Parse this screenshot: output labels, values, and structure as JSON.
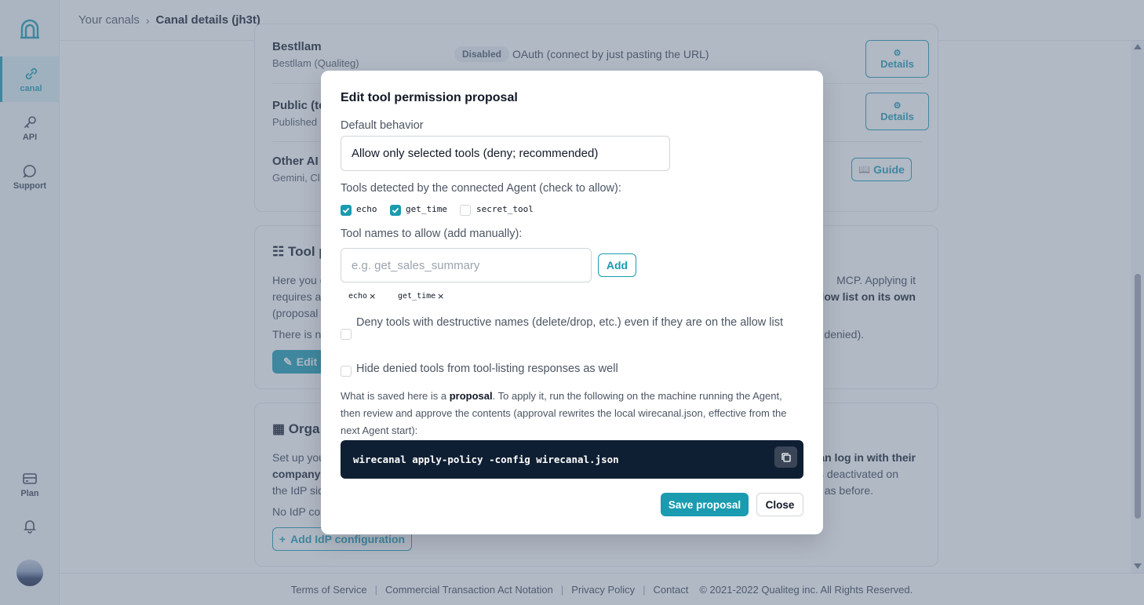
{
  "sidebar": {
    "logo_icon": "arch-logo-icon",
    "items": [
      {
        "label": "canal",
        "icon": "link-icon",
        "active": true
      },
      {
        "label": "API",
        "icon": "key-icon"
      },
      {
        "label": "Support",
        "icon": "chat-bubble-icon"
      },
      {
        "label": "Plan",
        "icon": "credit-card-icon"
      }
    ],
    "bell_icon": "bell-icon"
  },
  "header": {
    "breadcrumb_parent": "Your canals",
    "breadcrumb_current": "Canal details (jh3t)"
  },
  "background": {
    "rows": [
      {
        "title": "Bestllam",
        "subtitle": "Bestllam (Qualiteg)",
        "badge": "Disabled",
        "auth": "OAuth (connect by just pasting the URL)",
        "button": "Details"
      },
      {
        "title": "Public (te",
        "subtitle": "Published",
        "button": "Details"
      },
      {
        "title": "Other AI s",
        "subtitle": "Gemini, Cl",
        "button": "Guide"
      }
    ],
    "tool_card": {
      "title": "Tool p",
      "line1_left": "Here you c",
      "line1_right": "MCP. Applying it",
      "line2_left": "requires a",
      "line2_right": "llow list on its own",
      "line3_left": "(proposal",
      "line4_left": "There is n",
      "line4_right": "denied).",
      "edit_button": "Edit p"
    },
    "org_card": {
      "title": "Orga",
      "line1_left": "Set up you",
      "line1_right": "can log in with their",
      "line2_left": "company",
      "line2_right": "s deactivated on",
      "line3_left": "the IdP sid",
      "line3_right": "as before.",
      "line4_left": "No IdP co",
      "add_button": "Add IdP configuration"
    }
  },
  "footer": {
    "links": [
      "Terms of Service",
      "Commercial Transaction Act Notation",
      "Privacy Policy",
      "Contact"
    ],
    "copyright": "© 2021-2022 Qualiteg inc. All Rights Reserved."
  },
  "modal": {
    "title": "Edit tool permission proposal",
    "default_behavior_label": "Default behavior",
    "default_behavior_value": "Allow only selected tools (deny; recommended)",
    "detected_label": "Tools detected by the connected Agent (check to allow):",
    "detected_tools": [
      {
        "name": "echo",
        "checked": true
      },
      {
        "name": "get_time",
        "checked": true
      },
      {
        "name": "secret_tool",
        "checked": false
      }
    ],
    "manual_label": "Tool names to allow (add manually):",
    "manual_placeholder": "e.g. get_sales_summary",
    "add_button": "Add",
    "allowed_tags": [
      "echo",
      "get_time"
    ],
    "deny_destructive_label": "Deny tools with destructive names (delete/drop, etc.) even if they are on the allow list",
    "deny_destructive_checked": false,
    "hide_denied_label": "Hide denied tools from tool-listing responses as well",
    "hide_denied_checked": false,
    "note_before": "What is saved here is a ",
    "note_bold": "proposal",
    "note_after": ". To apply it, run the following on the machine running the Agent, then review and approve the contents (approval rewrites the local wirecanal.json, effective from the next Agent start):",
    "command": "wirecanal apply-policy -config wirecanal.json",
    "copy_icon": "copy-icon",
    "save_button": "Save proposal",
    "close_button": "Close"
  },
  "colors": {
    "accent": "#1a9bb0",
    "code_bg": "#0f1f33",
    "overlay": "rgba(100,116,139,0.5)"
  }
}
